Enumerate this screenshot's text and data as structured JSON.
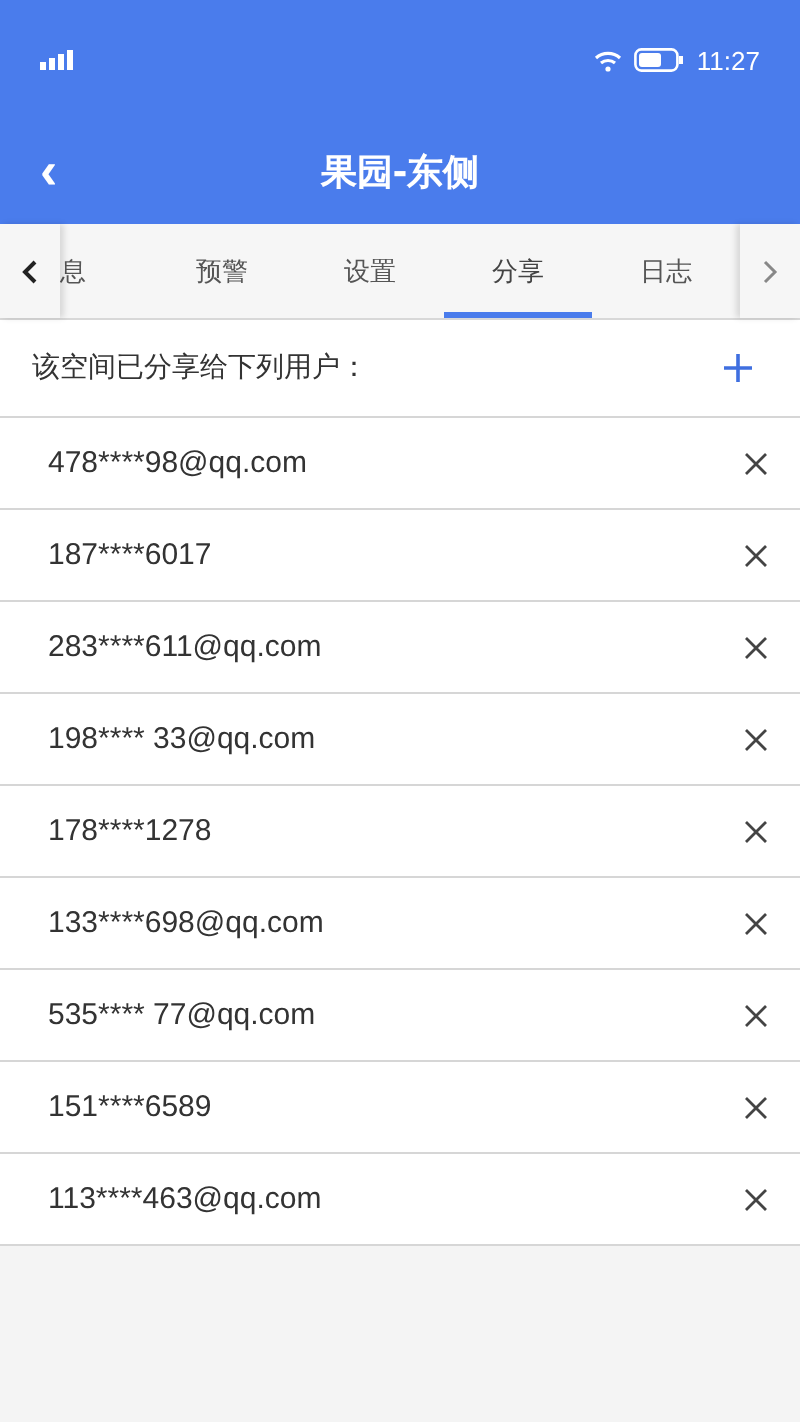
{
  "status_bar": {
    "time": "11:27"
  },
  "header": {
    "back": "‹",
    "title": "果园-东侧"
  },
  "tabs": [
    {
      "label": "息",
      "selected": false
    },
    {
      "label": "预警",
      "selected": false
    },
    {
      "label": "设置",
      "selected": false
    },
    {
      "label": "分享",
      "selected": true
    },
    {
      "label": "日志",
      "selected": false
    }
  ],
  "share": {
    "heading": "该空间已分享给下列用户：",
    "users": [
      {
        "account": "478****98@qq.com"
      },
      {
        "account": "187****6017"
      },
      {
        "account": "283****611@qq.com"
      },
      {
        "account": "198**** 33@qq.com"
      },
      {
        "account": "178****1278"
      },
      {
        "account": "133****698@qq.com"
      },
      {
        "account": "535**** 77@qq.com"
      },
      {
        "account": "151****6589"
      },
      {
        "account": "113****463@qq.com"
      }
    ]
  }
}
